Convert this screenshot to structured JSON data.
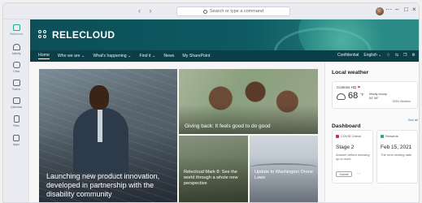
{
  "titlebar": {
    "nav_arrows": "‹ ›",
    "search_placeholder": "Search or type a command",
    "minimize": "–",
    "maximize": "□",
    "close": "×"
  },
  "rail": {
    "items": [
      {
        "label": "Relecloud",
        "icon": "relecloud-app-icon",
        "active": true
      },
      {
        "label": "Activity",
        "icon": "bell-icon"
      },
      {
        "label": "Chat",
        "icon": "chat-icon"
      },
      {
        "label": "Teams",
        "icon": "teams-icon"
      },
      {
        "label": "Calendar",
        "icon": "calendar-icon"
      },
      {
        "label": "Files",
        "icon": "file-icon"
      },
      {
        "label": "Apps",
        "icon": "apps-icon"
      }
    ]
  },
  "site": {
    "logo_text": "RELECLOUD",
    "nav": [
      "Home",
      "Who we are ⌄",
      "What's happening ⌄",
      "Find it ⌄",
      "News",
      "My SharePoint"
    ],
    "nav_right": {
      "confidential": "Confidential",
      "language": "English ⌄"
    }
  },
  "news": {
    "hero_title": "Launching new product innovation, developed in partnership with the disability community",
    "kids_title": "Giving back: It feels good to do good",
    "mark_title": "Relecloud Mark 8: See the world through a whole new perspective",
    "drone_title": "Update to Washington Drone Laws"
  },
  "weather": {
    "title": "Local weather",
    "location": "Contoso HQ",
    "temp": "68",
    "unit": "°F",
    "condition_line1": "Mostly cloudy",
    "condition_line2": "84° 66°",
    "source": "MSN Weather"
  },
  "dashboard": {
    "title": "Dashboard",
    "see_all": "See all",
    "cards": [
      {
        "header": "COVID Check",
        "big": "Stage 2",
        "small": "Answer before showing up to work",
        "button": "Submit",
        "accent": "#c4314b"
      },
      {
        "header": "Rewards",
        "big": "Feb 15, 2021",
        "small": "The next vesting date",
        "button": "",
        "accent": "#2aa391"
      }
    ]
  }
}
